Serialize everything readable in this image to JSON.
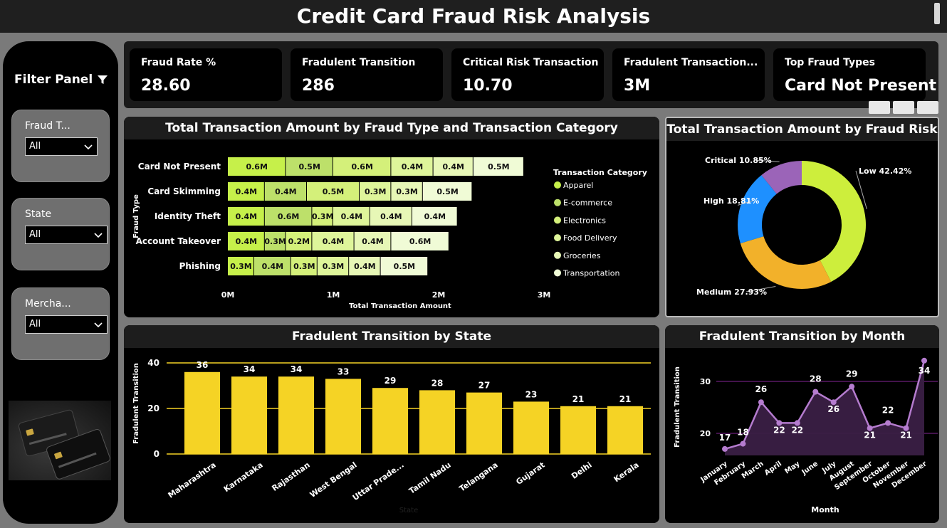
{
  "title": "Credit Card Fraud Risk Analysis",
  "filter_panel": {
    "title": "Filter Panel",
    "slicers": [
      {
        "label": "Fraud T...",
        "value": "All"
      },
      {
        "label": "State",
        "value": "All"
      },
      {
        "label": "Mercha...",
        "value": "All"
      }
    ]
  },
  "kpis": [
    {
      "title": "Fraud Rate %",
      "value": "28.60"
    },
    {
      "title": "Fradulent Transition",
      "value": "286"
    },
    {
      "title": "Critical Risk Transaction",
      "value": "10.70"
    },
    {
      "title": "Fradulent Transaction...",
      "value": "3M"
    },
    {
      "title": "Top Fraud Types",
      "value": "Card Not Present"
    }
  ],
  "chart_data": [
    {
      "type": "bar",
      "orientation": "horizontal-stacked",
      "title": "Total Transaction Amount by Fraud Type and Transaction Category",
      "xlabel": "Total Transaction Amount",
      "ylabel": "Fraud Type",
      "xlim": [
        0,
        3
      ],
      "xticks": [
        "0M",
        "1M",
        "2M",
        "3M"
      ],
      "legend_title": "Transaction Category",
      "legend_position": "right",
      "categories": [
        "Card Not Present",
        "Card Skimming",
        "Identity Theft",
        "Account Takeover",
        "Phishing"
      ],
      "series": [
        {
          "name": "Apparel",
          "color": "#c6f04a",
          "values": [
            0.55,
            0.35,
            0.35,
            0.35,
            0.25
          ],
          "labels": [
            "0.6M",
            "0.4M",
            "0.4M",
            "0.4M",
            "0.3M"
          ]
        },
        {
          "name": "E-commerce",
          "color": "#bde06a",
          "values": [
            0.45,
            0.4,
            0.45,
            0.2,
            0.35
          ],
          "labels": [
            "0.5M",
            "0.4M",
            "0.6M",
            "0.3M",
            "0.4M"
          ]
        },
        {
          "name": "Electronics",
          "color": "#d4f07a",
          "values": [
            0.55,
            0.5,
            0.2,
            0.25,
            0.25
          ],
          "labels": [
            "0.6M",
            "0.5M",
            "0.3M",
            "0.2M",
            "0.3M"
          ]
        },
        {
          "name": "Food Delivery",
          "color": "#def59a",
          "values": [
            0.4,
            0.3,
            0.35,
            0.4,
            0.3
          ],
          "labels": [
            "0.4M",
            "0.3M",
            "0.4M",
            "0.4M",
            "0.3M"
          ]
        },
        {
          "name": "Groceries",
          "color": "#e7f7b6",
          "values": [
            0.38,
            0.3,
            0.4,
            0.35,
            0.3
          ],
          "labels": [
            "0.4M",
            "0.3M",
            "0.4M",
            "0.4M",
            "0.4M"
          ]
        },
        {
          "name": "Transportation",
          "color": "#f0fbd6",
          "values": [
            0.48,
            0.47,
            0.43,
            0.55,
            0.45
          ],
          "labels": [
            "0.5M",
            "0.5M",
            "0.4M",
            "0.6M",
            "0.5M"
          ]
        }
      ]
    },
    {
      "type": "pie",
      "variant": "donut",
      "title": "Total Transaction Amount by Fraud Risk",
      "slices": [
        {
          "label": "Low",
          "value": 42.42,
          "display": "Low 42.42%",
          "color": "#cdee3c"
        },
        {
          "label": "Medium",
          "value": 27.93,
          "display": "Medium 27.93%",
          "color": "#f2b12a"
        },
        {
          "label": "High",
          "value": 18.81,
          "display": "High 18.81%",
          "color": "#1e90ff"
        },
        {
          "label": "Critical",
          "value": 10.85,
          "display": "Critical 10.85%",
          "color": "#9b64b8"
        }
      ]
    },
    {
      "type": "bar",
      "title": "Fradulent Transition by State",
      "xlabel": "State",
      "ylabel": "Fradulent Transition",
      "ylim": [
        0,
        40
      ],
      "yticks": [
        0,
        20,
        40
      ],
      "color": "#f5d325",
      "categories": [
        "Maharashtra",
        "Karnataka",
        "Rajasthan",
        "West Bengal",
        "Uttar Prade...",
        "Tamil Nadu",
        "Telangana",
        "Gujarat",
        "Delhi",
        "Kerala"
      ],
      "values": [
        36,
        34,
        34,
        33,
        29,
        28,
        27,
        23,
        21,
        21
      ]
    },
    {
      "type": "area",
      "title": "Fradulent Transition by Month",
      "xlabel": "Month",
      "ylabel": "Fradulent Transition",
      "yticks": [
        20,
        30
      ],
      "color": "#b57ccf",
      "categories": [
        "January",
        "February",
        "March",
        "April",
        "May",
        "June",
        "July",
        "August",
        "September",
        "October",
        "November",
        "December"
      ],
      "values": [
        17,
        18,
        26,
        22,
        22,
        28,
        26,
        29,
        21,
        22,
        21,
        34
      ]
    }
  ]
}
